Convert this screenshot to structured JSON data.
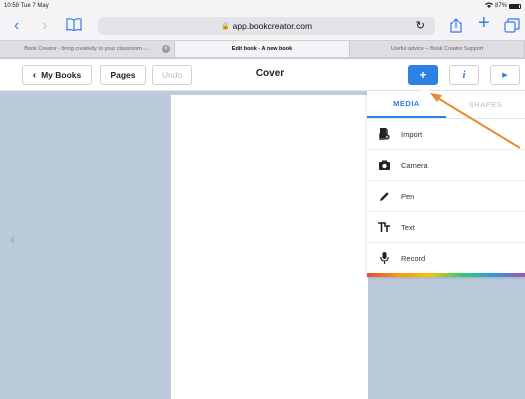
{
  "statusbar": {
    "time_date": "10:59  Tue 7 May",
    "battery": "87%"
  },
  "browser": {
    "url": "app.bookcreator.com",
    "tabs": [
      {
        "label": "Book Creator - bring creativity to your classroom -..."
      },
      {
        "label": "Edit book - A new book"
      },
      {
        "label": "Useful advice – Book Creator Support"
      }
    ]
  },
  "appbar": {
    "back_label": "My Books",
    "pages_label": "Pages",
    "undo_label": "Undo",
    "page_title": "Cover",
    "add_label": "+",
    "info_label": "i",
    "play_label": "▶"
  },
  "popover": {
    "tabs": [
      "MEDIA",
      "SHAPES"
    ],
    "items": [
      "Import",
      "Camera",
      "Pen",
      "Text",
      "Record"
    ]
  },
  "colors": {
    "accent": "#2b82e4",
    "annotation_arrow": "#e98a2f",
    "stage_bg": "#bccbdc"
  }
}
